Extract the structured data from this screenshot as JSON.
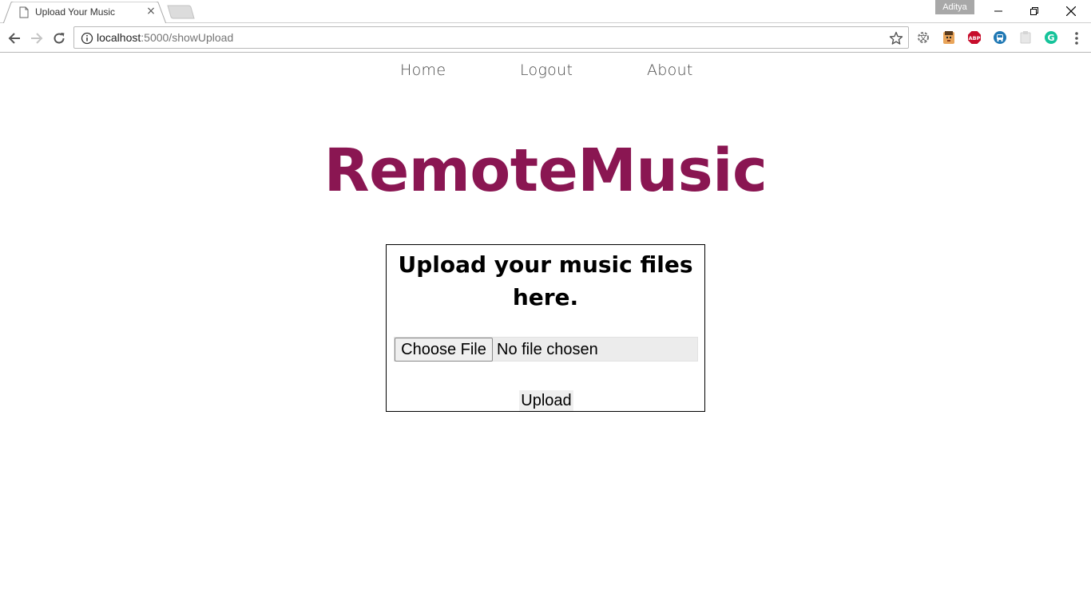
{
  "browser": {
    "tab_title": "Upload Your Music",
    "tab_close": "×",
    "profile_name": "Aditya",
    "url_host": "localhost",
    "url_path": ":5000/showUpload",
    "extensions": [
      "translate-icon",
      "face-extension-icon",
      "adblock-plus-icon",
      "bus-extension-icon",
      "blank-extension-icon",
      "grammarly-icon"
    ],
    "extension_labels": {
      "adblock": "ABP",
      "grammarly": "G"
    }
  },
  "nav": {
    "items": [
      {
        "label": "Home"
      },
      {
        "label": "Logout"
      },
      {
        "label": "About"
      }
    ]
  },
  "brand": {
    "title": "RemoteMusic"
  },
  "upload": {
    "heading_line1": "Upload your music files",
    "heading_line2": "here.",
    "choose_button": "Choose File",
    "file_status": "No file chosen",
    "submit_button": "Upload"
  },
  "colors": {
    "brand": "#8a1652",
    "nav_text": "#4a4a4a",
    "profile_badge": "#a8a8a8",
    "adblock_red": "#c70d2c",
    "grammarly_green": "#15c39a"
  }
}
